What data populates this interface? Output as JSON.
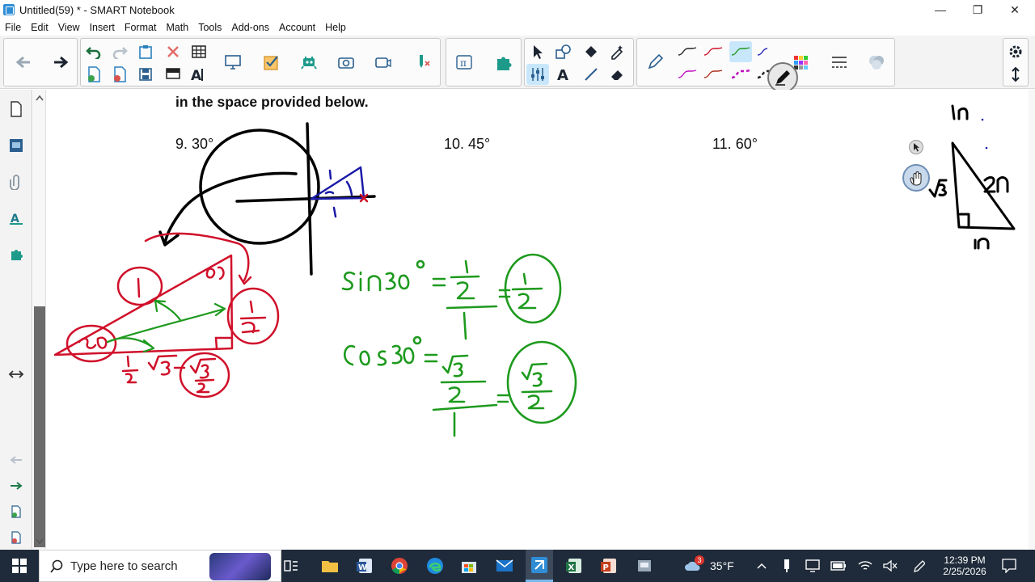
{
  "window": {
    "title": "Untitled(59) * - SMART Notebook",
    "minimize_glyph": "—",
    "restore_glyph": "❐",
    "close_glyph": "✕"
  },
  "menu": [
    "File",
    "Edit",
    "View",
    "Insert",
    "Format",
    "Math",
    "Tools",
    "Add-ons",
    "Account",
    "Help"
  ],
  "canvas": {
    "instruction": "in the space provided below.",
    "questions": [
      "9. 30°",
      "10. 45°",
      "11. 60°"
    ]
  },
  "taskbar": {
    "search_placeholder": "Type here to search",
    "weather_temp": "35°F",
    "weather_badge": "3",
    "time": "12:39 PM",
    "date": "2/25/2026"
  },
  "colors": {
    "toolbar_bg": "#f3f3f3",
    "selected_tool": "#c9e7fb",
    "ink_black": "#000000",
    "ink_blue": "#1a1aa8",
    "ink_red": "#d0102a",
    "ink_green": "#1e9a1e",
    "taskbar_bg": "#1f2b3a"
  }
}
